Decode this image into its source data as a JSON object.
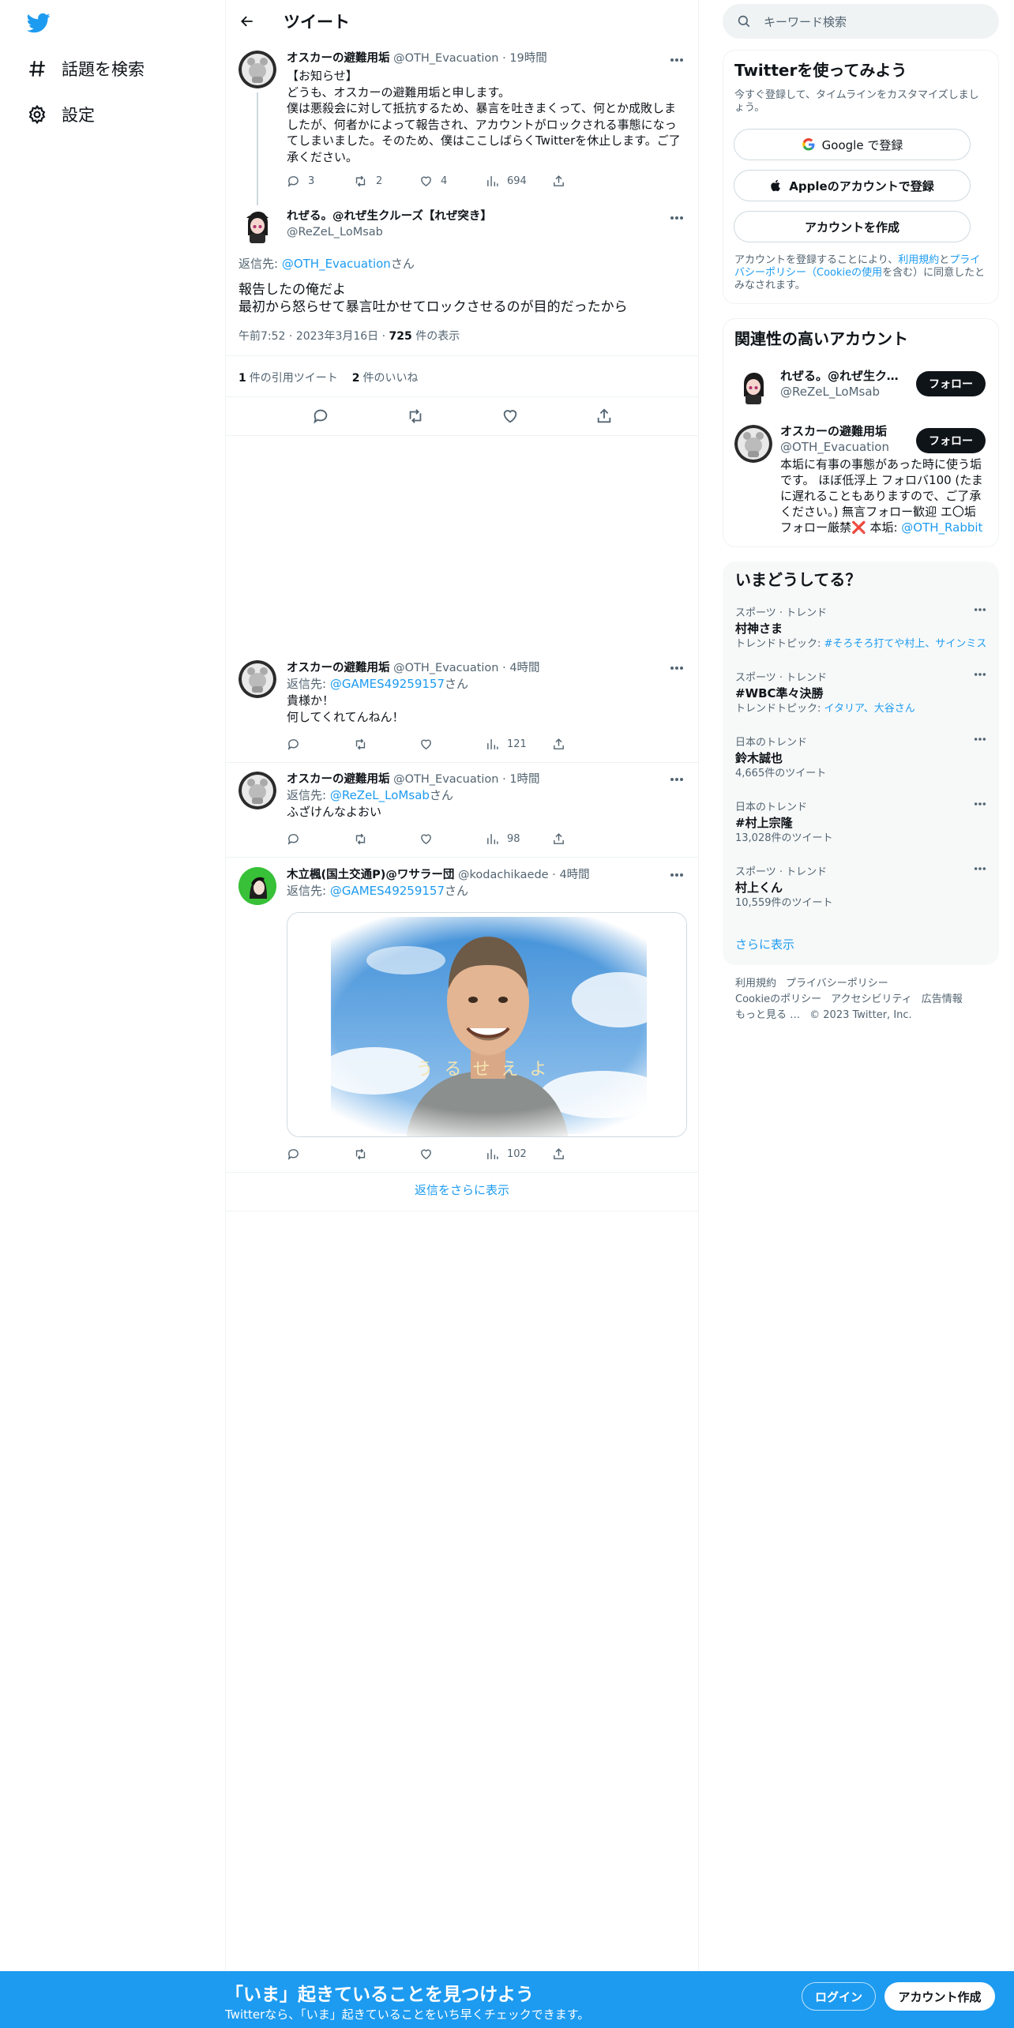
{
  "nav": {
    "logo": "twitter-bird-icon",
    "items": [
      {
        "label": "話題を検索",
        "icon": "hashtag-icon"
      },
      {
        "label": "設定",
        "icon": "gear-icon"
      }
    ]
  },
  "header": {
    "title": "ツイート"
  },
  "thread": {
    "parent": {
      "name": "オスカーの避難用垢",
      "handle": "@OTH_Evacuation",
      "sep": "·",
      "time": "19時間",
      "text": "【お知らせ】\nどうも、オスカーの避難用垢と申します。\n僕は悪殺会に対して抵抗するため、暴言を吐きまくって、何とか成敗しましたが、何者かによって報告され、アカウントがロックされる事態になってしまいました。そのため、僕はここしばらくTwitterを休止します。ご了承ください。",
      "replies": "3",
      "retweets": "2",
      "likes": "4",
      "views": "694"
    },
    "focus": {
      "name": "れぜる。@れぜ生クルーズ【れぜ突き】",
      "handle": "@ReZeL_LoMsab",
      "reply_prefix": "返信先: ",
      "reply_to": "@OTH_Evacuation",
      "reply_suffix": "さん",
      "text": "報告したの俺だよ\n最初から怒らせて暴言吐かせてロックさせるのが目的だったから",
      "time": "午前7:52",
      "sep1": "·",
      "date": "2023年3月16日",
      "sep2": "·",
      "views": "725",
      "views_label": "件の表示",
      "quote_count": "1",
      "quote_label": "件の引用ツイート",
      "like_count": "2",
      "like_label": "件のいいね"
    }
  },
  "replies": [
    {
      "name": "オスカーの避難用垢",
      "handle": "@OTH_Evacuation",
      "sep": "·",
      "time": "4時間",
      "reply_prefix": "返信先: ",
      "reply_to": "@GAMES49259157",
      "reply_suffix": "さん",
      "text": "貴様か！\n何してくれてんねん！",
      "views": "121"
    },
    {
      "name": "オスカーの避難用垢",
      "handle": "@OTH_Evacuation",
      "sep": "·",
      "time": "1時間",
      "reply_prefix": "返信先: ",
      "reply_to": "@ReZeL_LoMsab",
      "reply_suffix": "さん",
      "text": "ふざけんなよおい",
      "views": "98"
    },
    {
      "name": "木立楓(国土交通P)@ワサラー団",
      "handle": "@kodachikaede",
      "sep": "·",
      "time": "4時間",
      "reply_prefix": "返信先: ",
      "reply_to": "@GAMES49259157",
      "reply_suffix": "さん",
      "image_caption": "うるせえよ",
      "views": "102"
    }
  ],
  "show_more_replies": "返信をさらに表示",
  "right": {
    "search_placeholder": "キーワード検索",
    "signup_card": {
      "title": "Twitterを使ってみよう",
      "subtitle": "今すぐ登録して、タイムラインをカスタマイズしましょう。",
      "google": "Google で登録",
      "apple": "Appleのアカウントで登録",
      "create": "アカウントを作成",
      "terms_a": "アカウントを登録することにより、",
      "terms_link1": "利用規約",
      "terms_b": "と",
      "terms_link2": "プライバシーポリシー（Cookieの使用",
      "terms_c": "を含む）に同意したとみなされます。"
    },
    "related": {
      "title": "関連性の高いアカウント",
      "accounts": [
        {
          "name": "れぜる。@れぜ生クルーズ【れぜ突き】",
          "handle": "@ReZeL_LoMsab",
          "follow": "フォロー"
        },
        {
          "name": "オスカーの避難用垢",
          "handle": "@OTH_Evacuation",
          "follow": "フォロー",
          "bio": "本垢に有事の事態があった時に使う垢です。 ほぼ低浮上 フォロバ100 (たまに遅れることもありますので、ご了承ください。) 無言フォロー歓迎 エ〇垢フォロー厳禁❌ 本垢: ",
          "bio_link": "@OTH_Rabbit"
        }
      ]
    },
    "trends": {
      "title": "いまどうしてる？",
      "items": [
        {
          "category": "スポーツ · トレンド",
          "title": "村神さま",
          "sub_prefix": "トレンドトピック: ",
          "sub_link": "#そろそろ打てや村上、サインミス"
        },
        {
          "category": "スポーツ · トレンド",
          "title": "#WBC準々決勝",
          "sub_prefix": "トレンドトピック: ",
          "sub_link": "イタリア、大谷さん"
        },
        {
          "category": "日本のトレンド",
          "title": "鈴木誠也",
          "sub_prefix": "4,665件のツイート",
          "sub_link": ""
        },
        {
          "category": "日本のトレンド",
          "title": "#村上宗隆",
          "sub_prefix": "13,028件のツイート",
          "sub_link": ""
        },
        {
          "category": "スポーツ · トレンド",
          "title": "村上くん",
          "sub_prefix": "10,559件のツイート",
          "sub_link": ""
        }
      ],
      "show_more": "さらに表示"
    },
    "footer": {
      "line1": [
        "利用規約",
        "プライバシーポリシー"
      ],
      "line2": [
        "Cookieのポリシー",
        "アクセシビリティ",
        "広告情報"
      ],
      "line3": [
        "もっと見る …",
        "© 2023 Twitter, Inc."
      ]
    }
  },
  "bottom_bar": {
    "title": "「いま」起きていることを見つけよう",
    "subtitle": "Twitterなら、「いま」起きていることをいち早くチェックできます。",
    "login": "ログイン",
    "signup": "アカウント作成"
  },
  "colors": {
    "accent": "#1d9bf0",
    "text": "#0f1419",
    "muted": "#536471",
    "border": "#eff3f4"
  }
}
